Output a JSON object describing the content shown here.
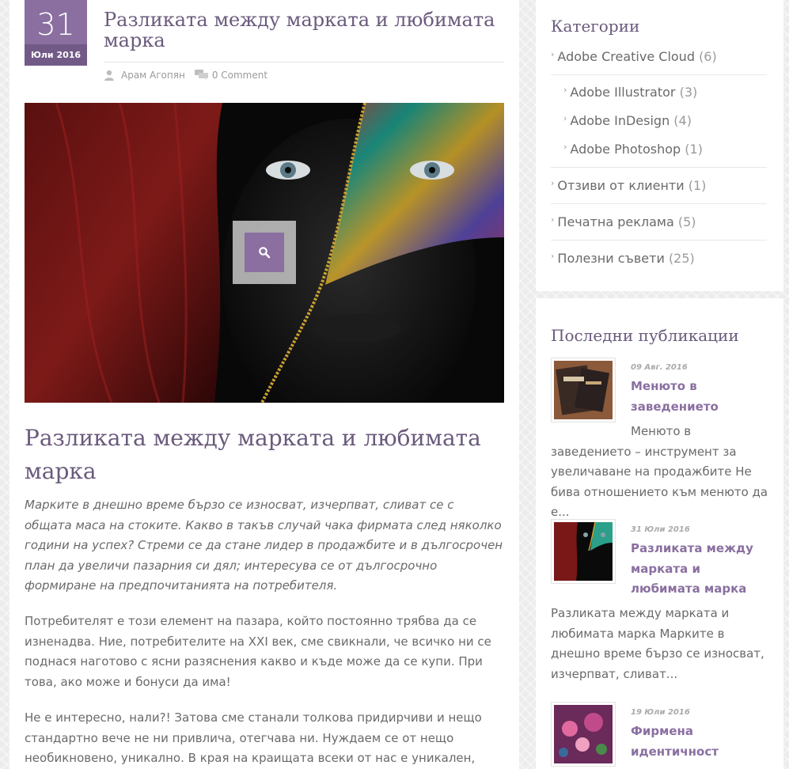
{
  "post": {
    "date_day": "31",
    "date_month": "Юли 2016",
    "title": "Разликата между марката и любимата марка",
    "author": "Арам Агопян",
    "comments": "0 Comment",
    "headline": "Разликата между марката и любимата марка",
    "lead": "Марките в днешно време бързо се износват, изчерпват, сливат се с общата маса на стоките. Какво в такъв случай чака фирмата след няколко години на успех? Стреми се да стане лидер в продажбите и в дългосрочен план да увеличи пазарния си дял; интересува се от дългосрочно формиране на предпочитанията на потребителя.",
    "paragraphs": [
      "Потребителят е този елемент на пазара, който постоянно трябва да се изненадва. Ние, потребителите на XXI век, сме свикнали, че всичко ни се поднася наготово с ясни разяснения какво и къде може да се купи. При това, ако може и бонуси да има!",
      "Не е интересно, нали?! Затова сме станали толкова придирчиви и нещо стандартно вече не ни привлича, отегчава ни. Нуждаем се от нещо необикновено, уникално. В края на краищата всеки от нас е уникален, неповторим. Което"
    ]
  },
  "sidebar": {
    "categories_title": "Категории",
    "categories": [
      {
        "label": "Adobe Creative Cloud",
        "count": "(6)"
      },
      {
        "label": "Adobe Illustrator",
        "count": "(3)"
      },
      {
        "label": "Adobe InDesign",
        "count": "(4)"
      },
      {
        "label": "Adobe Photoshop",
        "count": "(1)"
      },
      {
        "label": "Отзиви от клиенти",
        "count": "(1)"
      },
      {
        "label": "Печатна реклама",
        "count": "(5)"
      },
      {
        "label": "Полезни съвети",
        "count": "(25)"
      }
    ],
    "recent_title": "Последни публикации",
    "recent": [
      {
        "date": "09 Авг. 2016",
        "title": "Менюто в заведението",
        "excerpt_first": "Менюто в",
        "excerpt_rest": "заведението – инструмент за увеличаване на продажбите Не бива отношението към менюто да е..."
      },
      {
        "date": "31 Юли 2016",
        "title": "Разликата между марката и любимата марка",
        "excerpt": "Разликата между марката и любимата марка Марките в днешно време бързо се износват, изчерпват, сливат..."
      },
      {
        "date": "19 Юли 2016",
        "title": "Фирмена идентичност",
        "excerpt": ""
      }
    ]
  },
  "colors": {
    "accent": "#8a6fa0",
    "accent_dark": "#725a87",
    "title": "#6a5a7c"
  },
  "icons": {
    "author": "user-icon",
    "comments": "comment-icon",
    "zoom": "search-icon",
    "bullet": "chevron-right-icon"
  }
}
